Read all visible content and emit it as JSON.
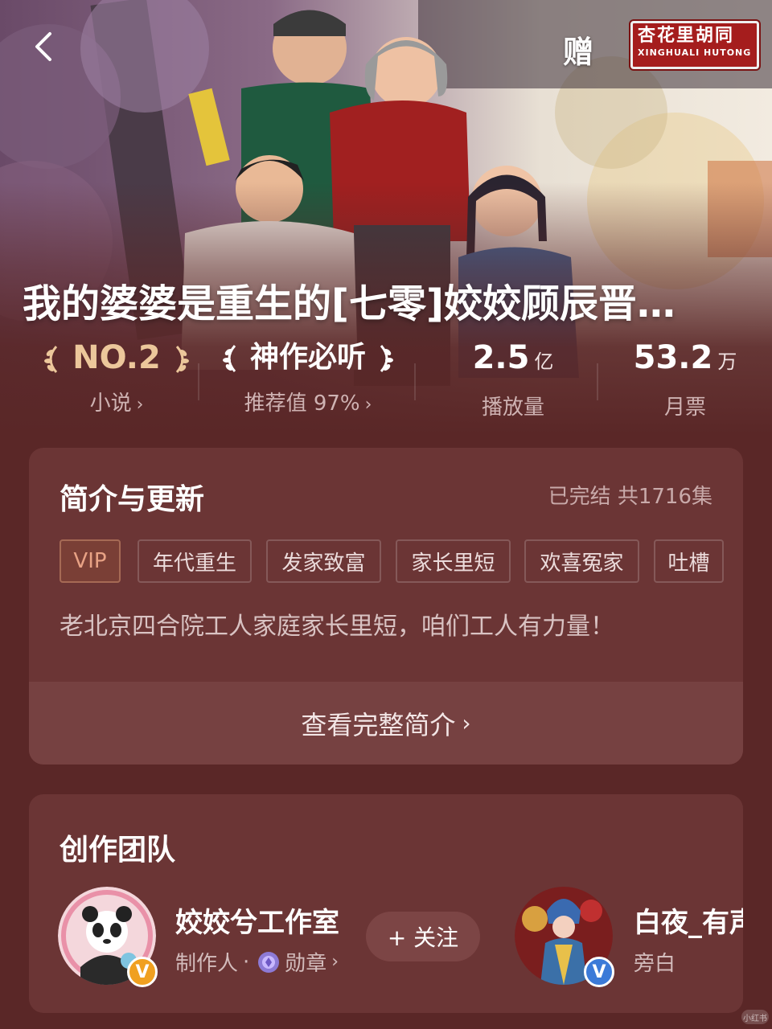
{
  "header": {
    "gift_label": "赠",
    "sign_line1": "杏花里胡同",
    "sign_line2": "XINGHUALI HUTONG"
  },
  "book": {
    "title": "我的婆婆是重生的[七零]姣姣顾辰晋…"
  },
  "stats": {
    "rank": {
      "value": "NO.2",
      "label": "小说"
    },
    "tag": {
      "value": "神作必听",
      "label": "推荐值 97%"
    },
    "plays": {
      "value": "2.5",
      "unit": "亿",
      "label": "播放量"
    },
    "tickets": {
      "value": "53.2",
      "unit": "万",
      "label": "月票"
    }
  },
  "intro": {
    "title": "简介与更新",
    "status": "已完结 共1716集",
    "tags": [
      "VIP",
      "年代重生",
      "发家致富",
      "家长里短",
      "欢喜冤家",
      "吐槽"
    ],
    "description": "老北京四合院工人家庭家长里短，咱们工人有力量！",
    "more_label": "查看完整简介"
  },
  "team": {
    "title": "创作团队",
    "members": [
      {
        "name": "姣姣兮工作室",
        "role": "制作人",
        "separator": "·",
        "medal": "勋章",
        "badge": "V"
      },
      {
        "name": "白夜_有声",
        "role": "旁白",
        "badge": "V"
      }
    ],
    "follow_label": "+ 关注"
  },
  "colors": {
    "background": "#5a2727",
    "card": "#6b3535",
    "gold": "#ecc79b",
    "vip": "#e8a285",
    "badge": "#f0a020"
  },
  "icons": {
    "back": "chevron-left-icon",
    "chevron": "chevron-right-icon",
    "laurel": "laurel-icon",
    "medal": "medal-icon",
    "verified": "verified-badge-icon"
  }
}
